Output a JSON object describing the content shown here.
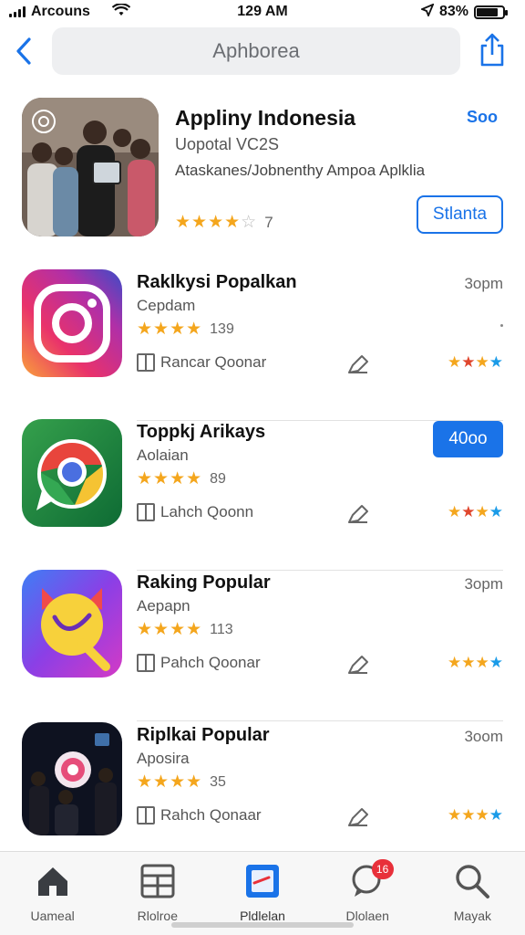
{
  "status_bar": {
    "carrier": "Arcouns",
    "time": "129 AM",
    "battery": "83%",
    "battery_level": 0.83,
    "icons": [
      "signal-icon",
      "wifi-icon",
      "location-arrow-icon",
      "battery-icon"
    ]
  },
  "header": {
    "back_icon": "chevron-left-icon",
    "search_placeholder": "Aphborea",
    "share_icon": "share-icon"
  },
  "featured": {
    "title": "Appliny Indonesia",
    "version": "Uopotal VC2S",
    "description": "Ataskanes/Jobnenthy Ampoa Aplklia",
    "rating_value": 3.5,
    "rating_count": "7",
    "see_label": "Soo",
    "action_label": "Stlanta"
  },
  "apps": [
    {
      "name": "Raklkysi Popalkan",
      "subtitle": "Cepdam",
      "rating_count": "139",
      "time": "3opm",
      "meta": "Rancar Qoonar",
      "mini_rating": "★★★★",
      "icon": "instagram-style-icon"
    },
    {
      "name": "Toppkj Arikays",
      "subtitle": "Aolaian",
      "rating_count": "89",
      "action_label": "40oo",
      "meta": "Lahch Qoonn",
      "mini_rating": "★★★★",
      "icon": "chrome-style-icon"
    },
    {
      "name": "Raking Popular",
      "subtitle": "Aepapn",
      "rating_count": "113",
      "time": "3opm",
      "meta": "Pahch Qoonar",
      "mini_rating": "★★★★",
      "icon": "game-app-icon"
    },
    {
      "name": "Riplkai Popular",
      "subtitle": "Aposira",
      "rating_count": "35",
      "time": "3oom",
      "meta": "Rahch Qonaar",
      "mini_rating": "★★★★",
      "icon": "photo-app-icon"
    }
  ],
  "tabs": [
    {
      "label": "Uameal",
      "icon": "home-icon"
    },
    {
      "label": "Rlolroe",
      "icon": "grid-icon"
    },
    {
      "label": "Pldlelan",
      "icon": "apps-icon"
    },
    {
      "label": "Dlolaen",
      "icon": "chat-icon",
      "badge": "16"
    },
    {
      "label": "Mayak",
      "icon": "search-icon"
    }
  ],
  "colors": {
    "accent": "#1a73e8",
    "star": "#f4a61d",
    "badge": "#e8303a"
  }
}
